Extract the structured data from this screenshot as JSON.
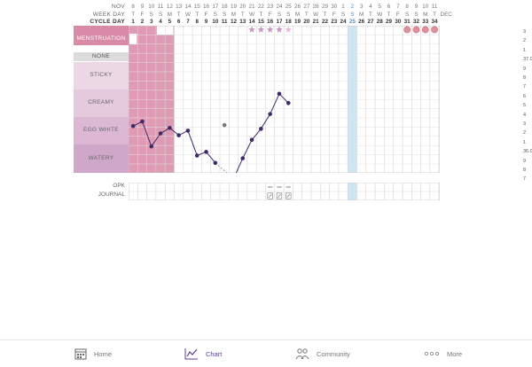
{
  "header": {
    "month_label": "NOV",
    "weekday_label": "WEEK DAY",
    "cycleday_label": "CYCLE DAY",
    "end_month": "DEC",
    "dates": [
      "8",
      "9",
      "10",
      "11",
      "12",
      "13",
      "14",
      "15",
      "16",
      "17",
      "18",
      "19",
      "20",
      "21",
      "22",
      "23",
      "24",
      "25",
      "26",
      "27",
      "28",
      "29",
      "30",
      "1",
      "2",
      "3",
      "4",
      "5",
      "6",
      "7",
      "8",
      "9",
      "10",
      "11"
    ],
    "weekdays": [
      "T",
      "F",
      "S",
      "S",
      "M",
      "T",
      "W",
      "T",
      "F",
      "S",
      "S",
      "M",
      "T",
      "W",
      "T",
      "F",
      "S",
      "S",
      "M",
      "T",
      "W",
      "T",
      "F",
      "S",
      "S",
      "M",
      "T",
      "W",
      "T",
      "F",
      "S",
      "S",
      "M",
      "T"
    ],
    "cycle_days": [
      "1",
      "2",
      "3",
      "4",
      "5",
      "6",
      "7",
      "8",
      "9",
      "10",
      "11",
      "12",
      "13",
      "14",
      "15",
      "16",
      "17",
      "18",
      "19",
      "20",
      "21",
      "22",
      "23",
      "24",
      "25",
      "26",
      "27",
      "28",
      "29",
      "30",
      "31",
      "32",
      "33",
      "34"
    ]
  },
  "labels": {
    "menstruation": "MENSTRUATION",
    "none": "NONE",
    "sticky": "STICKY",
    "creamy": "CREAMY",
    "egg_white": "EGG WHITE",
    "watery": "WATERY",
    "opk": "OPK",
    "journal": "JOURNAL"
  },
  "temperature_axis": [
    "3",
    "2",
    "1",
    "37.0",
    "9",
    "8",
    "7",
    "6",
    "5",
    "4",
    "3",
    "2",
    "1",
    "36.0",
    "9",
    "8",
    "7"
  ],
  "temperature_series": {
    "values": [
      36.25,
      36.3,
      36.03,
      36.17,
      36.23,
      36.15,
      36.2,
      35.93,
      35.97,
      35.85,
      null,
      35.68,
      35.9,
      36.1,
      36.22,
      36.38,
      36.6,
      36.5
    ],
    "outlier_day_index": 10,
    "outlier_value": 36.26
  },
  "fertile_marks": {
    "star_days": [
      13,
      14,
      15,
      16,
      17
    ],
    "dot_days": [
      30,
      31,
      32,
      33
    ]
  },
  "selected_day_index": 24,
  "colors": {
    "period": "#d98aa6",
    "menstruation_band": "#d98aa6",
    "none_band": "#dcdcdc",
    "sticky_band": "#ecd8e5",
    "creamy_band": "#e5cadd",
    "egg_white_band": "#dcb8d5",
    "watery_band": "#cfa8c9",
    "temp_line": "#3f2a6b",
    "selected_col": "#cce6f6",
    "accent": "#5b3f8f"
  },
  "tabs": [
    {
      "label": "Home",
      "icon": "calendar-icon"
    },
    {
      "label": "Chart",
      "icon": "chart-icon"
    },
    {
      "label": "Community",
      "icon": "community-icon"
    },
    {
      "label": "More",
      "icon": "more-icon"
    }
  ]
}
